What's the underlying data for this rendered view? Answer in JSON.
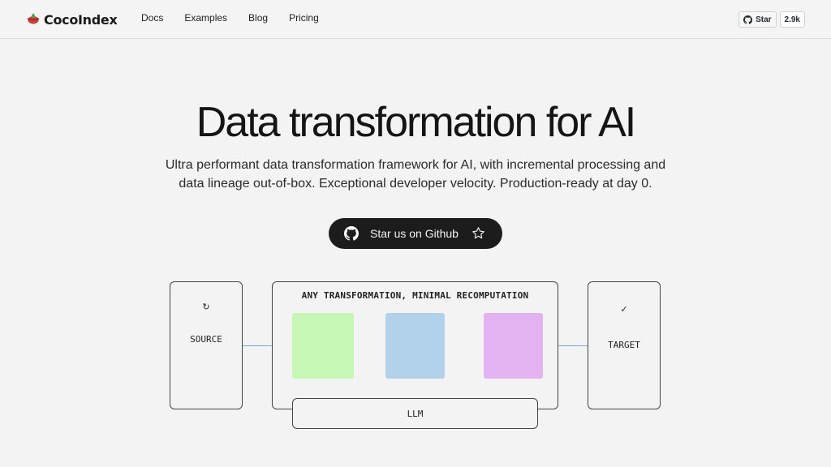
{
  "header": {
    "brand": "CocoIndex",
    "nav": [
      "Docs",
      "Examples",
      "Blog",
      "Pricing"
    ],
    "github_star_label": "Star",
    "github_star_count": "2.9k"
  },
  "hero": {
    "title": "Data transformation for AI",
    "subtitle_line1": "Ultra performant data transformation framework for AI, with incremental processing and",
    "subtitle_line2": "data lineage out-of-box. Exceptional developer velocity. Production-ready at day 0.",
    "cta_label": "Star us on Github"
  },
  "diagram": {
    "source_icon": "↻",
    "source_label": "SOURCE",
    "transform_title": "ANY TRANSFORMATION, MINIMAL RECOMPUTATION",
    "target_icon": "✓",
    "target_label": "TARGET",
    "llm_label": "LLM",
    "tile_colors": [
      "#c7f7b4",
      "#b1d2ea",
      "#e3b3f1"
    ],
    "connector_color": "#7ba7cf"
  },
  "colors": {
    "background": "#f3f3f3",
    "cta_bg": "#1c1c1c",
    "text": "#1c1c1c"
  },
  "icons": {
    "logo": "coconut-logo-icon",
    "github": "github-icon",
    "star": "star-outline-icon"
  }
}
